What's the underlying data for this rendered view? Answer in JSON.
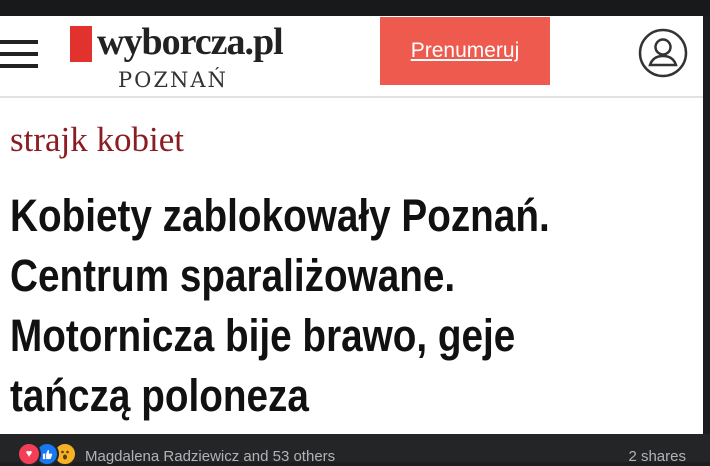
{
  "site": {
    "logo_text": "wyborcza.pl",
    "city": "POZNAŃ",
    "subscribe_label": "Prenumeruj"
  },
  "article": {
    "section": "strajk kobiet",
    "headline_lines": [
      "Kobiety zablokowały Poznań.",
      "Centrum sparaliżowane.",
      "Motornicza bije brawo, geje",
      "tańczą poloneza"
    ]
  },
  "post_footer": {
    "reactions": [
      "love",
      "like",
      "wow"
    ],
    "reacted_by": "Magdalena Radziewicz and 53 others",
    "shares": "2 shares"
  },
  "colors": {
    "brand_red": "#e2322e",
    "subscribe_bg": "#ee5a4e",
    "section_label": "#8a1c22"
  }
}
